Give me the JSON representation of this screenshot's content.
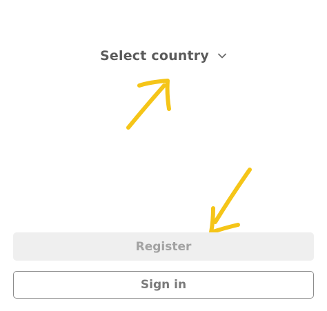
{
  "country_selector": {
    "label": "Select country",
    "icon": "chevron-down-icon"
  },
  "buttons": {
    "register_label": "Register",
    "signin_label": "Sign in"
  },
  "annotations": {
    "color": "#f5c518",
    "arrow_up_icon": "arrow-up-right-icon",
    "arrow_down_icon": "arrow-down-left-icon"
  },
  "colors": {
    "selector_text": "#5a5a5a",
    "register_bg": "#efefef",
    "register_text": "#a2a2a2",
    "signin_border": "#8c8c8c",
    "signin_text": "#7a7a7a"
  }
}
